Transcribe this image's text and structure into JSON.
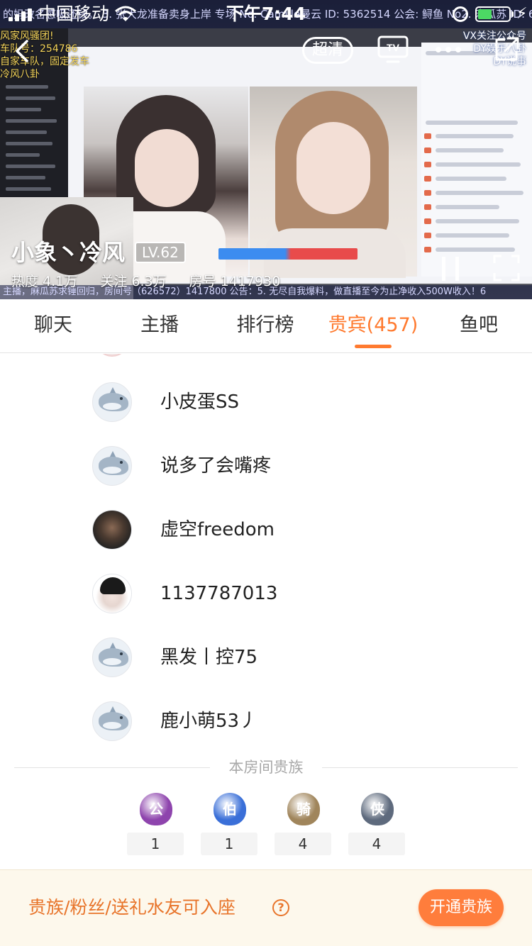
{
  "status_bar": {
    "carrier": "中国移动",
    "time": "下午7:44",
    "battery_level": 0.45
  },
  "player": {
    "quality_label": "超清",
    "tv_label": "TV",
    "top_marquee": "的妈改名感吸还钱。 3. 张大龙准备卖身上岸 专场 No. Camille曼云 ID: 5362514 公会: 鲟鱼 No2. 麻瓜苏 ID: 626572 公会",
    "bottom_marquee": "主播，麻瓜苏求锤回归，房间号（626572）1417800 公告：5. 无尽自我爆料，做直播至今为止净收入500W收入！6",
    "overlay_left_lines": [
      "风家风骚团!",
      "车队号：254786",
      "自家车队，固定发车",
      "冷风八卦"
    ],
    "overlay_right_lines": [
      "VX关注公众号",
      "DY娱乐八卦",
      "DY说事"
    ]
  },
  "anchor": {
    "name": "小象丶冷风",
    "level": "LV.62",
    "heat": "热度 4.1万",
    "follow": "关注 6.3万",
    "room": "房号 1417930"
  },
  "tabs": [
    {
      "label": "聊天"
    },
    {
      "label": "主播"
    },
    {
      "label": "排行榜"
    },
    {
      "label": "贵宾(457)"
    },
    {
      "label": "鱼吧"
    }
  ],
  "guests": [
    {
      "name": "小皮蛋SS",
      "avatar": "shark"
    },
    {
      "name": "说多了会嘴疼",
      "avatar": "shark"
    },
    {
      "name": "虚空freedom",
      "avatar": "photo"
    },
    {
      "name": "1137787013",
      "avatar": "photo"
    },
    {
      "name": "黑发丨控75",
      "avatar": "shark"
    },
    {
      "name": "鹿小萌53丿",
      "avatar": "shark"
    }
  ],
  "nobility": {
    "title": "本房间贵族",
    "items": [
      {
        "badge": "公",
        "count": "1",
        "color": "#8e44ad"
      },
      {
        "badge": "伯",
        "count": "1",
        "color": "#3a6fd8"
      },
      {
        "badge": "骑",
        "count": "4",
        "color": "#a0855b"
      },
      {
        "badge": "侠",
        "count": "4",
        "color": "#5e6a7d"
      }
    ]
  },
  "bottom_bar": {
    "text": "贵族/粉丝/送礼水友可入座",
    "help": "?",
    "button": "开通贵族"
  }
}
